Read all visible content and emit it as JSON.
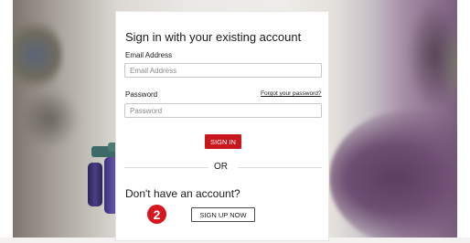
{
  "signin": {
    "title": "Sign in with your existing account",
    "email_label": "Email Address",
    "email_placeholder": "Email Address",
    "email_value": "",
    "password_label": "Password",
    "password_placeholder": "Password",
    "password_value": "",
    "forgot_link": "Forgot your password?",
    "signin_button": "SIGN IN"
  },
  "divider": {
    "text": "OR"
  },
  "signup": {
    "prompt": "Don't have an account?",
    "step_number": "2",
    "button": "SIGN UP NOW"
  },
  "colors": {
    "accent": "#c8171d",
    "card_bg": "#ffffff",
    "text": "#1a1a1a",
    "backdrop_purple": "#6e4f73"
  }
}
